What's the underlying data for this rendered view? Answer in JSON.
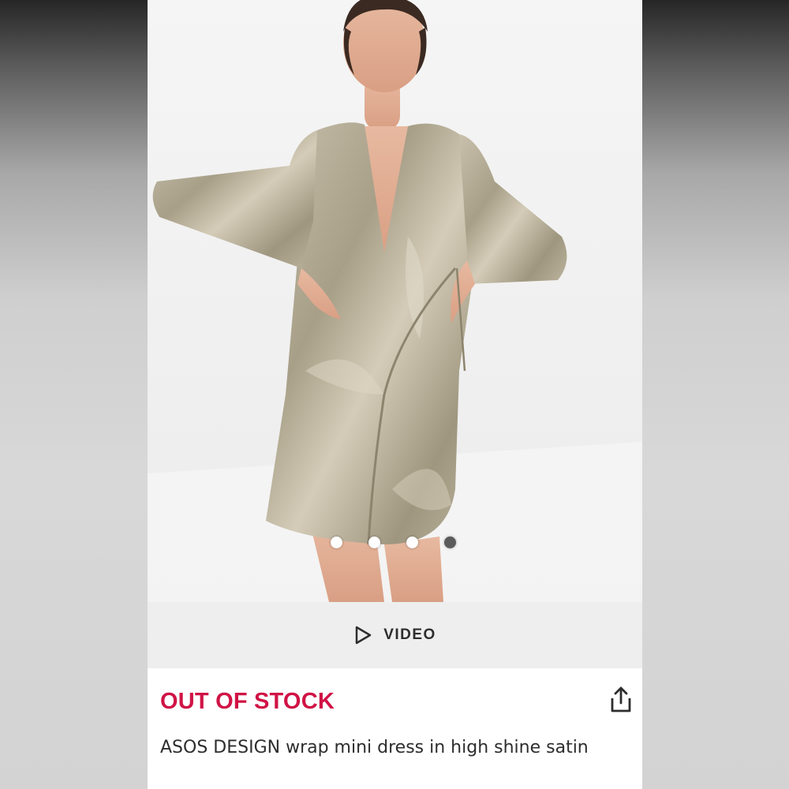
{
  "product": {
    "image_alt": "model wearing satin wrap mini dress",
    "carousel": {
      "total": 4,
      "active_index": 3
    },
    "video_label": "VIDEO",
    "stock_status": "OUT OF STOCK",
    "title": "ASOS DESIGN wrap mini dress in high shine satin"
  },
  "colors": {
    "stock_accent": "#d01345",
    "text": "#2d2d2d",
    "video_bar_bg": "#eeeeee",
    "dress": "#b3aa95"
  },
  "icons": {
    "video": "play-icon",
    "share": "share-icon"
  }
}
